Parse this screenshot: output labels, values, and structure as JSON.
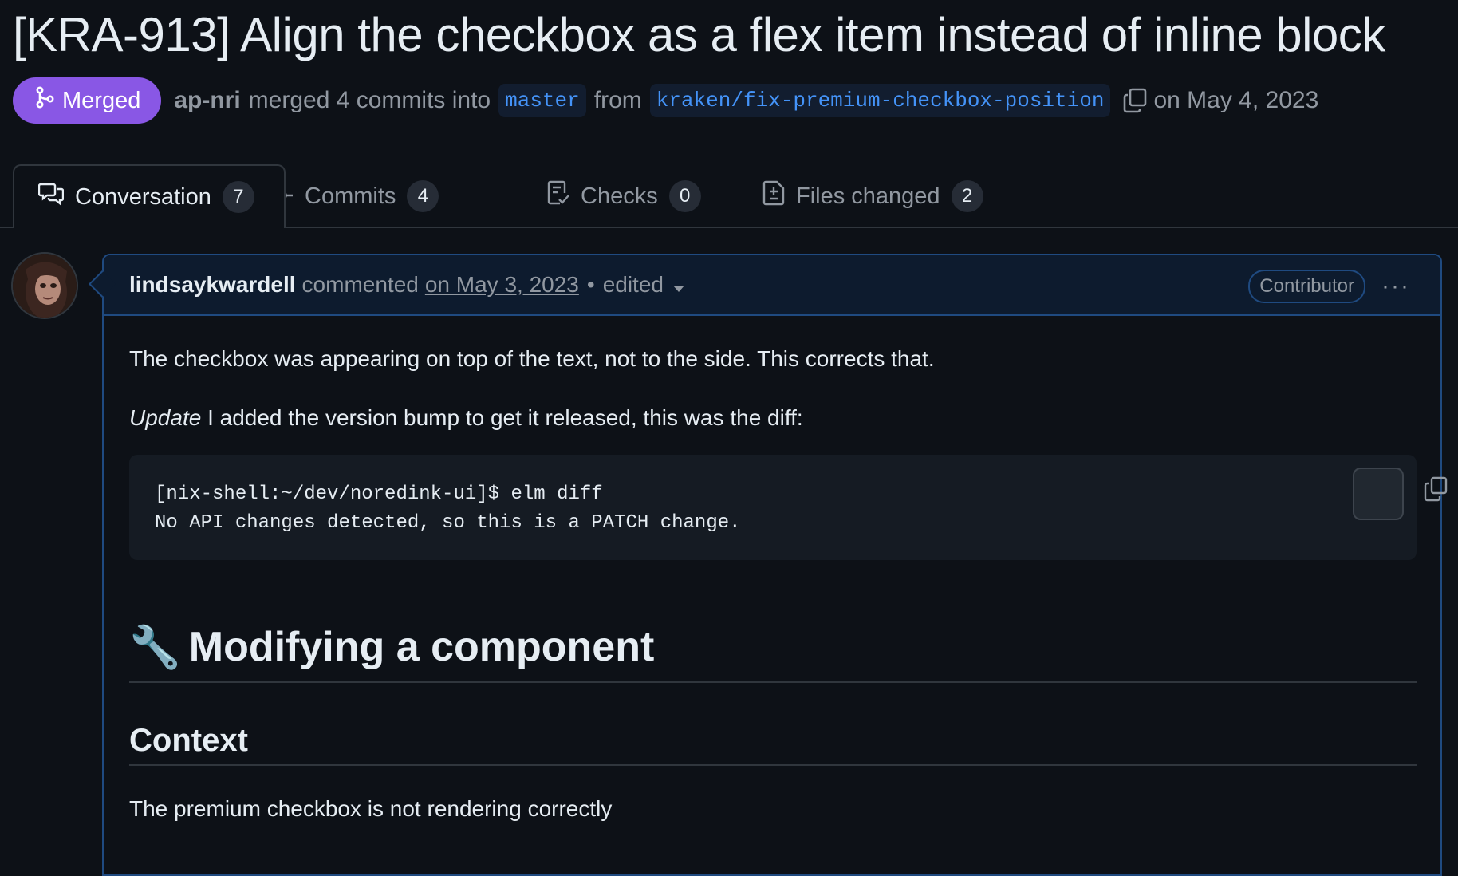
{
  "pr": {
    "title": "[KRA-913] Align the checkbox as a flex item instead of inline block",
    "state_label": "Merged",
    "author": "ap-nri",
    "merge_text": "merged 4 commits into",
    "base_branch": "master",
    "from_text": "from",
    "head_branch": "kraken/fix-premium-checkbox-position",
    "merged_date": "on May 4, 2023"
  },
  "tabs": [
    {
      "label": "Conversation",
      "count": "7",
      "icon": "comment-discussion-icon"
    },
    {
      "label": "Commits",
      "count": "4",
      "icon": "git-commit-icon"
    },
    {
      "label": "Checks",
      "count": "0",
      "icon": "checklist-icon"
    },
    {
      "label": "Files changed",
      "count": "2",
      "icon": "file-diff-icon"
    }
  ],
  "comment": {
    "author": "lindsaykwardell",
    "action": "commented",
    "date": "on May 3, 2023",
    "separator": "•",
    "edited_label": "edited",
    "role_badge": "Contributor",
    "menu_label": "···",
    "paragraph1": "The checkbox was appearing on top of the text, not to the side. This corrects that.",
    "update_em": "Update",
    "update_text": " I added the version bump to get it released, this was the diff:",
    "code_lines": "[nix-shell:~/dev/noredink-ui]$ elm diff\nNo API changes detected, so this is a PATCH change.",
    "heading_emoji": "🔧",
    "heading": "Modifying a component",
    "subheading": "Context",
    "paragraph3": "The premium checkbox is not rendering correctly"
  },
  "colors": {
    "background": "#0d1117",
    "merged": "#8957e5",
    "branch_text": "#4493f8",
    "comment_border": "#1f4a80"
  }
}
